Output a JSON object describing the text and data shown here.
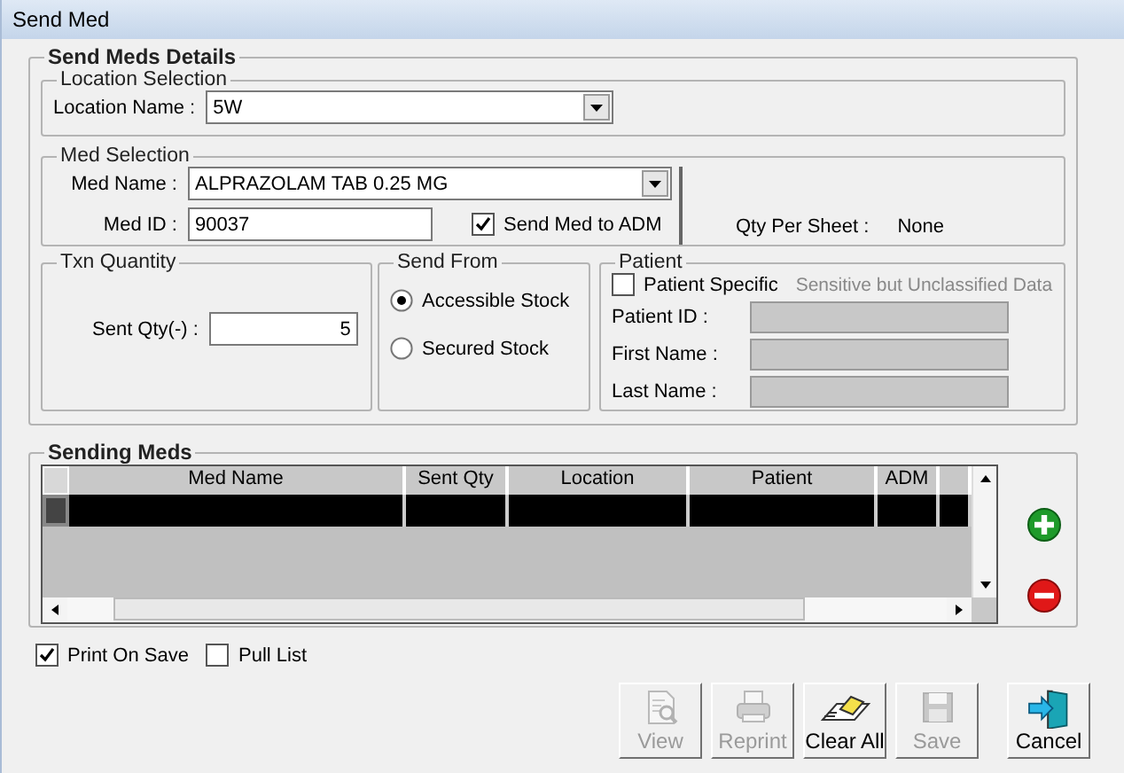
{
  "window": {
    "title": "Send Med"
  },
  "details": {
    "title": "Send Meds Details",
    "location_selection": {
      "title": "Location Selection",
      "label": "Location Name :",
      "value": "5W"
    },
    "med_selection": {
      "title": "Med Selection",
      "med_name_label": "Med Name :",
      "med_name": "ALPRAZOLAM TAB 0.25 MG",
      "med_id_label": "Med ID :",
      "med_id": "90037",
      "send_to_adm": {
        "label": "Send Med to ADM",
        "checked": true
      },
      "qty_per_sheet_label": "Qty Per Sheet :",
      "qty_per_sheet": "None"
    },
    "txn_quantity": {
      "title": "Txn Quantity",
      "label": "Sent Qty(-) :",
      "value": "5"
    },
    "send_from": {
      "title": "Send From",
      "options": [
        {
          "label": "Accessible Stock",
          "selected": true
        },
        {
          "label": "Secured Stock",
          "selected": false
        }
      ]
    },
    "patient": {
      "title": "Patient",
      "patient_specific": {
        "label": "Patient Specific",
        "checked": false
      },
      "note": "Sensitive but Unclassified Data",
      "fields": [
        {
          "label": "Patient ID  :",
          "disabled": true
        },
        {
          "label": "First Name :",
          "disabled": true
        },
        {
          "label": "Last Name :",
          "disabled": true
        }
      ]
    }
  },
  "sending_meds": {
    "title": "Sending Meds",
    "columns": [
      "Med Name",
      "Sent Qty",
      "Location",
      "Patient",
      "ADM"
    ],
    "rows": [
      {
        "selected": true
      }
    ]
  },
  "options": [
    {
      "label": "Print On Save",
      "checked": true
    },
    {
      "label": "Pull List",
      "checked": false
    }
  ],
  "buttons": [
    {
      "label": "View",
      "kind": "view",
      "disabled": true
    },
    {
      "label": "Reprint",
      "kind": "print",
      "disabled": true
    },
    {
      "label": "Clear All",
      "kind": "clear",
      "disabled": false
    },
    {
      "label": "Save",
      "kind": "save",
      "disabled": true
    },
    {
      "label": "Cancel",
      "kind": "exit",
      "disabled": false
    }
  ]
}
